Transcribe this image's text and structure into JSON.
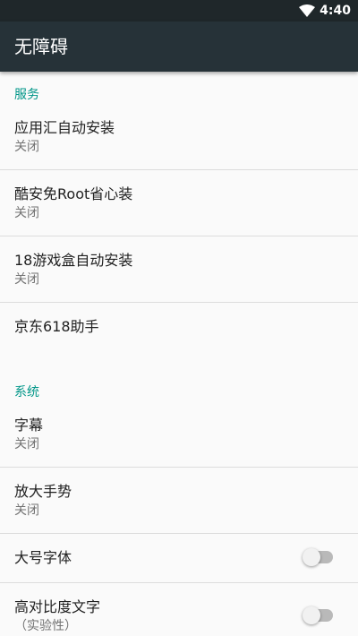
{
  "status_bar": {
    "time": "4:40"
  },
  "app_bar": {
    "title": "无障碍"
  },
  "sections": [
    {
      "header": "服务",
      "items": [
        {
          "title": "应用汇自动安装",
          "summary": "关闭"
        },
        {
          "title": "酷安免Root省心装",
          "summary": "关闭"
        },
        {
          "title": "18游戏盒自动安装",
          "summary": "关闭"
        },
        {
          "title": "京东618助手"
        }
      ]
    },
    {
      "header": "系统",
      "items": [
        {
          "title": "字幕",
          "summary": "关闭"
        },
        {
          "title": "放大手势",
          "summary": "关闭"
        },
        {
          "title": "大号字体",
          "toggle": "off"
        },
        {
          "title": "高对比度文字",
          "summary": "（实验性）",
          "toggle": "off"
        }
      ]
    }
  ],
  "colors": {
    "status_bar": "#1f272a",
    "app_bar": "#263238",
    "accent": "#009688",
    "background": "#fafafa"
  }
}
